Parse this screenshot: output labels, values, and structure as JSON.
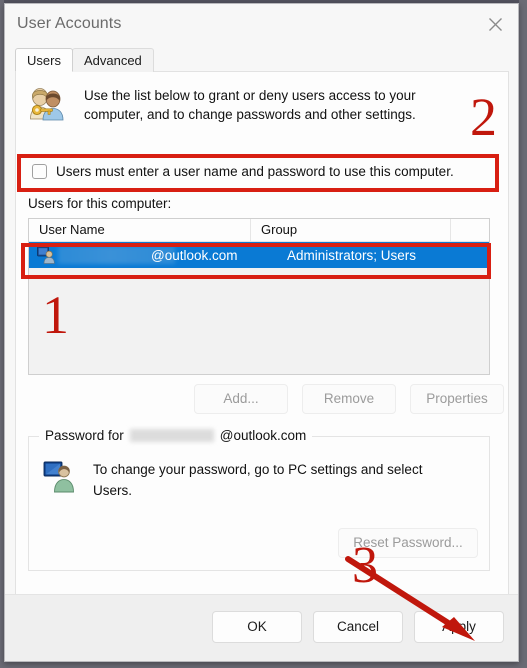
{
  "window": {
    "title": "User Accounts",
    "close_icon": "close-icon"
  },
  "tabs": [
    {
      "label": "Users",
      "active": true
    },
    {
      "label": "Advanced",
      "active": false
    }
  ],
  "description": {
    "icon": "users-with-key-icon",
    "text": "Use the list below to grant or deny users access to your computer, and to change passwords and other settings."
  },
  "checkbox": {
    "label": "Users must enter a user name and password to use this computer.",
    "checked": false
  },
  "list": {
    "label": "Users for this computer:",
    "columns": [
      "User Name",
      "Group"
    ],
    "rows": [
      {
        "icon": "user-account-icon",
        "user_name_redacted": true,
        "user_name": "@outlook.com",
        "group": "Administrators; Users",
        "selected": true
      }
    ]
  },
  "list_buttons": [
    {
      "label": "Add...",
      "enabled": false
    },
    {
      "label": "Remove",
      "enabled": false
    },
    {
      "label": "Properties",
      "enabled": false
    }
  ],
  "password_group": {
    "legend_prefix": "Password for",
    "legend_redacted": true,
    "legend_suffix": "@outlook.com",
    "icon": "user-at-monitor-icon",
    "text": "To change your password, go to PC settings and select Users.",
    "reset_button": {
      "label": "Reset Password...",
      "enabled": false
    }
  },
  "dialog_buttons": [
    {
      "label": "OK",
      "enabled": true
    },
    {
      "label": "Cancel",
      "enabled": true
    },
    {
      "label": "Apply",
      "enabled": true
    }
  ],
  "annotations": {
    "step_1": "1",
    "step_2": "2",
    "step_3": "3",
    "highlight_color": "#d81f12",
    "arrow_target": "Apply"
  }
}
